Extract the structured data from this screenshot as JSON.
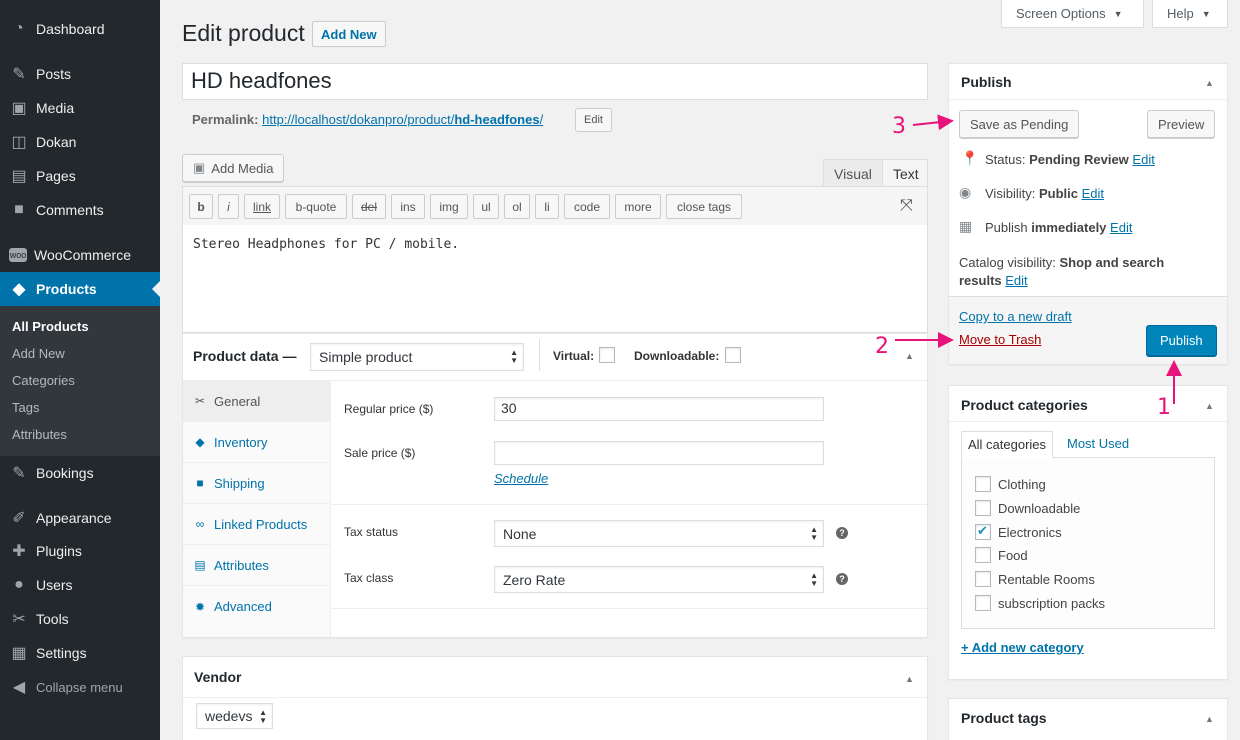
{
  "sidebar": {
    "menu": [
      {
        "label": "Dashboard",
        "icon": "dashboard-icon"
      },
      {
        "label": "Posts",
        "icon": "pin-icon"
      },
      {
        "label": "Media",
        "icon": "media-icon"
      },
      {
        "label": "Dokan",
        "icon": "dokan-icon"
      },
      {
        "label": "Pages",
        "icon": "pages-icon"
      },
      {
        "label": "Comments",
        "icon": "comments-icon"
      },
      {
        "label": "WooCommerce",
        "icon": "woocommerce-icon"
      },
      {
        "label": "Products",
        "icon": "box-icon"
      },
      {
        "label": "Bookings",
        "icon": "pin-icon"
      },
      {
        "label": "Appearance",
        "icon": "brush-icon"
      },
      {
        "label": "Plugins",
        "icon": "plugin-icon"
      },
      {
        "label": "Users",
        "icon": "user-icon"
      },
      {
        "label": "Tools",
        "icon": "wrench-icon"
      },
      {
        "label": "Settings",
        "icon": "settings-icon"
      },
      {
        "label": "Collapse menu",
        "icon": "collapse-icon"
      }
    ],
    "products_submenu": [
      "All Products",
      "Add New",
      "Categories",
      "Tags",
      "Attributes"
    ]
  },
  "top": {
    "screen_options": "Screen Options",
    "help": "Help"
  },
  "header": {
    "title": "Edit product",
    "add_new": "Add New"
  },
  "post": {
    "title": "HD headfones",
    "permalink_label": "Permalink:",
    "permalink_base": "http://localhost/dokanpro/product/",
    "permalink_slug": "hd-headfones",
    "permalink_suffix": "/",
    "permalink_edit": "Edit"
  },
  "editor": {
    "add_media": "Add Media",
    "tab_visual": "Visual",
    "tab_text": "Text",
    "buttons": [
      "b",
      "i",
      "link",
      "b-quote",
      "del",
      "ins",
      "img",
      "ul",
      "ol",
      "li",
      "code",
      "more",
      "close tags"
    ],
    "content": "Stereo Headphones for PC / mobile."
  },
  "product_data": {
    "label": "Product data —",
    "type": "Simple product",
    "virtual": "Virtual:",
    "downloadable": "Downloadable:",
    "tabs": [
      {
        "label": "General",
        "icon": "wrench-icon"
      },
      {
        "label": "Inventory",
        "icon": "tag-icon"
      },
      {
        "label": "Shipping",
        "icon": "truck-icon"
      },
      {
        "label": "Linked Products",
        "icon": "link-icon"
      },
      {
        "label": "Attributes",
        "icon": "list-icon"
      },
      {
        "label": "Advanced",
        "icon": "gear-icon"
      }
    ],
    "regular_price_label": "Regular price ($)",
    "regular_price": "30",
    "sale_price_label": "Sale price ($)",
    "sale_price": "",
    "schedule": "Schedule",
    "tax_status_label": "Tax status",
    "tax_status": "None",
    "tax_class_label": "Tax class",
    "tax_class": "Zero Rate"
  },
  "vendor": {
    "title": "Vendor",
    "value": "wedevs"
  },
  "publish": {
    "title": "Publish",
    "save_pending": "Save as Pending",
    "preview": "Preview",
    "status_label": "Status:",
    "status_value": "Pending Review",
    "visibility_label": "Visibility:",
    "visibility_value": "Public",
    "publish_label": "Publish",
    "publish_value": "immediately",
    "catalog_label": "Catalog visibility:",
    "catalog_value_1": "Shop and search",
    "catalog_value_2": "results",
    "edit": "Edit",
    "copy_draft": "Copy to a new draft",
    "trash": "Move to Trash",
    "publish_btn": "Publish"
  },
  "categories": {
    "title": "Product categories",
    "tab_all": "All categories",
    "tab_most": "Most Used",
    "items": [
      {
        "label": "Clothing",
        "checked": false
      },
      {
        "label": "Downloadable",
        "checked": false
      },
      {
        "label": "Electronics",
        "checked": true
      },
      {
        "label": "Food",
        "checked": false
      },
      {
        "label": "Rentable Rooms",
        "checked": false
      },
      {
        "label": "subscription packs",
        "checked": false
      }
    ],
    "add_new": "+ Add new category"
  },
  "tags": {
    "title": "Product tags"
  },
  "annotations": {
    "a1": "1",
    "a2": "2",
    "a3": "3"
  },
  "colors": {
    "accent": "#0073aa",
    "annotation": "#e8137a",
    "sidebar": "#23282d",
    "trash": "#a00"
  }
}
